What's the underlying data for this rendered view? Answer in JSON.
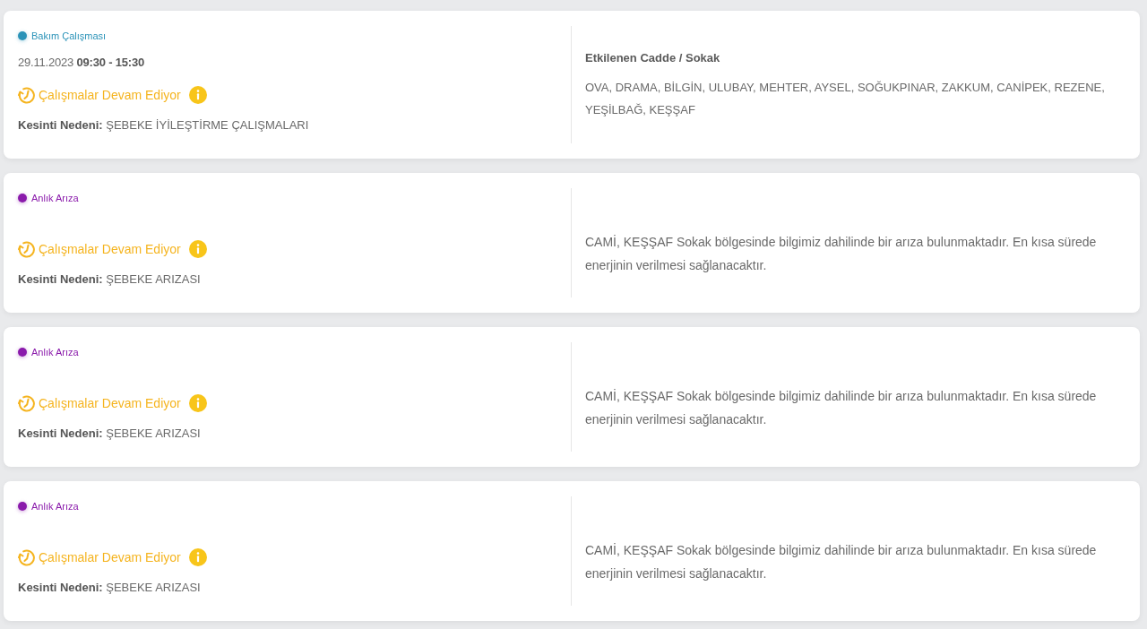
{
  "outages": [
    {
      "type": {
        "label": "Bakım Çalışması",
        "color": "#2b93b8"
      },
      "schedule": "29.11.2023 **09:30 - 15:30**",
      "status": {
        "label": "Çalışmalar Devam Ediyor",
        "kind": "in_progress"
      },
      "reason": "**Kesinti Nedeni:** ŞEBEKE İYİLEŞTİRME ÇALIŞMALARI",
      "affected_title": "Etkilenen Cadde / Sokak",
      "details": "OVA, DRAMA, BİLGİN, ULUBAY, MEHTER, AYSEL, SOĞUKPINAR, ZAKKUM, CANİPEK, REZENE, YEŞİLBAĞ, KEŞŞAF"
    },
    {
      "type": {
        "label": "Anlık Arıza",
        "color": "#8a1aab"
      },
      "status": {
        "label": "Çalışmalar Devam Ediyor",
        "kind": "in_progress"
      },
      "reason": "**Kesinti Nedeni:** ŞEBEKE ARIZASI",
      "details": "CAMİ, KEŞŞAF Sokak bölgesinde bilgimiz dahilinde bir arıza bulunmaktadır. En kısa sürede enerjinin verilmesi sağlanacaktır."
    },
    {
      "type": {
        "label": "Anlık Arıza",
        "color": "#8a1aab"
      },
      "status": {
        "label": "Çalışmalar Devam Ediyor",
        "kind": "in_progress"
      },
      "reason": "**Kesinti Nedeni:** ŞEBEKE ARIZASI",
      "details": "CAMİ, KEŞŞAF Sokak bölgesinde bilgimiz dahilinde bir arıza bulunmaktadır. En kısa sürede enerjinin verilmesi sağlanacaktır."
    },
    {
      "type": {
        "label": "Anlık Arıza",
        "color": "#8a1aab"
      },
      "status": {
        "label": "Çalışmalar Devam Ediyor",
        "kind": "in_progress"
      },
      "reason": "**Kesinti Nedeni:** ŞEBEKE ARIZASI",
      "details": "CAMİ, KEŞŞAF Sokak bölgesinde bilgimiz dahilinde bir arıza bulunmaktadır. En kısa sürede enerjinin verilmesi sağlanacaktır."
    }
  ]
}
